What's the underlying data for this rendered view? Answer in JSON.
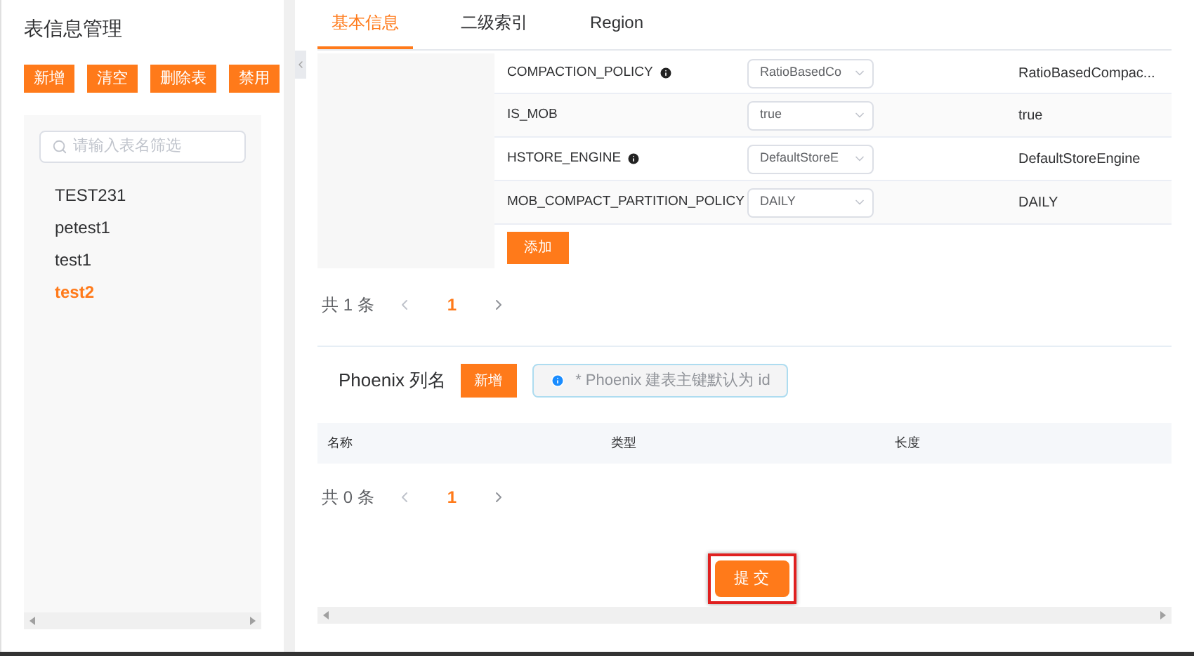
{
  "sidebar": {
    "title": "表信息管理",
    "buttons": [
      "新增",
      "清空",
      "删除表",
      "禁用"
    ],
    "search": {
      "placeholder": "请输入表名筛选"
    },
    "items": [
      {
        "label": "TEST231",
        "selected": false
      },
      {
        "label": "petest1",
        "selected": false
      },
      {
        "label": "test1",
        "selected": false
      },
      {
        "label": "test2",
        "selected": true
      }
    ]
  },
  "tabs": [
    {
      "label": "基本信息",
      "selected": true
    },
    {
      "label": "二级索引",
      "selected": false
    },
    {
      "label": "Region",
      "selected": false
    }
  ],
  "properties": [
    {
      "name": "COMPACTION_POLICY",
      "info": true,
      "select": "RatioBasedCo",
      "value": "RatioBasedCompac..."
    },
    {
      "name": "IS_MOB",
      "info": false,
      "select": "true",
      "value": "true"
    },
    {
      "name": "HSTORE_ENGINE",
      "info": true,
      "select": "DefaultStoreE",
      "value": "DefaultStoreEngine"
    },
    {
      "name": "MOB_COMPACT_PARTITION_POLICY",
      "info": false,
      "select": "DAILY",
      "value": "DAILY"
    }
  ],
  "add_button": "添加",
  "pagination": {
    "total": "共 1 条",
    "page": "1"
  },
  "phoenix": {
    "title": "Phoenix 列名",
    "add_button": "新增",
    "tip": "* Phoenix 建表主键默认为 id",
    "columns": [
      "名称",
      "类型",
      "长度"
    ],
    "pagination": {
      "total": "共 0 条",
      "page": "1"
    }
  },
  "submit": "提 交"
}
